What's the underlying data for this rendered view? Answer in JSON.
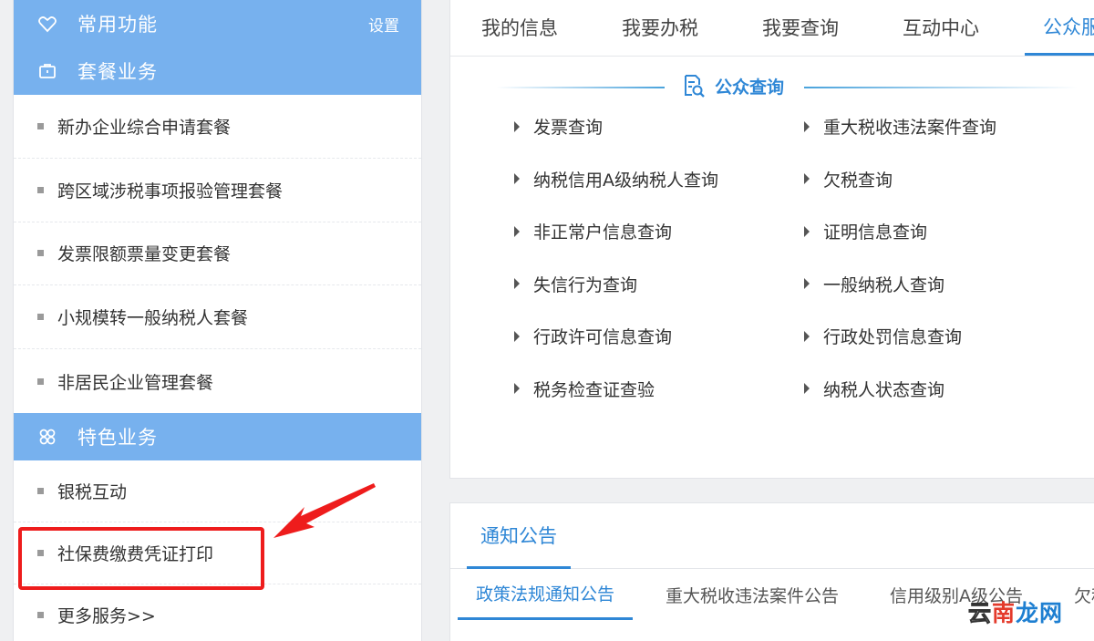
{
  "sidebar": {
    "common": {
      "title": "常用功能",
      "settings": "设置",
      "icon": "heart-icon"
    },
    "package": {
      "title": "套餐业务",
      "icon": "briefcase-icon",
      "items": [
        "新办企业综合申请套餐",
        "跨区域涉税事项报验管理套餐",
        "发票限额票量变更套餐",
        "小规模转一般纳税人套餐",
        "非居民企业管理套餐"
      ]
    },
    "special": {
      "title": "特色业务",
      "icon": "grid-icon",
      "items": [
        "银税互动",
        "社保费缴费凭证打印",
        "更多服务>>"
      ]
    }
  },
  "tabs": [
    "我的信息",
    "我要办税",
    "我要查询",
    "互动中心",
    "公众服务"
  ],
  "public_query": {
    "title": "公众查询",
    "icon": "search-doc-icon",
    "left": [
      "发票查询",
      "纳税信用A级纳税人查询",
      "非正常户信息查询",
      "失信行为查询",
      "行政许可信息查询",
      "税务检查证查验"
    ],
    "right": [
      "重大税收违法案件查询",
      "欠税查询",
      "证明信息查询",
      "一般纳税人查询",
      "行政处罚信息查询",
      "纳税人状态查询"
    ]
  },
  "notice": {
    "tab": "通知公告",
    "sub_tabs": [
      "政策法规通知公告",
      "重大税收违法案件公告",
      "信用级别A级公告",
      "欠税"
    ]
  },
  "watermark": {
    "part1": "云",
    "part2": "南",
    "part3": "龙网"
  },
  "colors": {
    "accent": "#2f87d6",
    "sidebar_header": "#77b1ee",
    "highlight": "#ee1c1c"
  }
}
